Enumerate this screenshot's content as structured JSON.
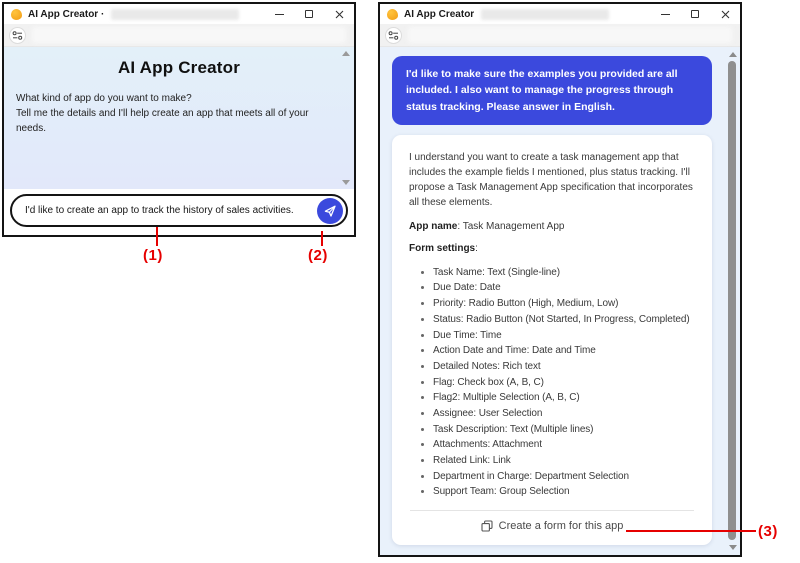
{
  "colors": {
    "accent": "#3b49dd",
    "annotation_red": "#e60000",
    "window_bg": "#e9f1fb",
    "left_gradient_top": "#e3f0f9",
    "left_gradient_bottom": "#e2e8fa"
  },
  "left_window": {
    "title": "AI App Creator ·",
    "welcome_heading": "AI App Creator",
    "welcome_line1": "What kind of app do you want to make?",
    "welcome_line2": "Tell me the details and I'll help create an app that meets all of your needs.",
    "input_value": "I'd like to create an app to track the history of sales activities."
  },
  "right_window": {
    "title": "AI App Creator",
    "user_message": "I'd like to make sure the examples you provided are all included. I also want to manage the progress through status tracking. Please answer in English.",
    "response": {
      "intro": "I understand you want to create a task management app that includes the example fields I mentioned, plus status tracking. I'll propose a Task Management App specification that incorporates all these elements.",
      "app_name_label": "App name",
      "app_name_value": ": Task Management App",
      "form_settings_label": "Form settings",
      "form_settings_suffix": ":",
      "fields": [
        "Task Name: Text (Single-line)",
        "Due Date: Date",
        "Priority: Radio Button (High, Medium, Low)",
        "Status: Radio Button (Not Started, In Progress, Completed)",
        "Due Time: Time",
        "Action Date and Time: Date and Time",
        "Detailed Notes: Rich text",
        "Flag: Check box (A, B, C)",
        "Flag2: Multiple Selection (A, B, C)",
        "Assignee: User Selection",
        "Task Description: Text (Multiple lines)",
        "Attachments: Attachment",
        "Related Link: Link",
        "Department in Charge: Department Selection",
        "Support Team: Group Selection"
      ],
      "create_form_label": "Create a form for this app"
    }
  },
  "annotations": {
    "n1": "(1)",
    "n2": "(2)",
    "n3": "(3)"
  }
}
